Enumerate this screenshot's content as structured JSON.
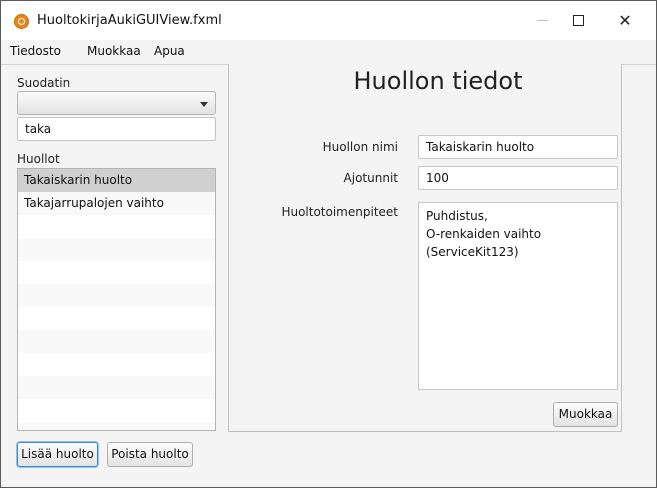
{
  "window": {
    "title": "HuoltokirjaAukiGUIView.fxml",
    "app_icon": "app-icon",
    "minimize_icon": "minimize-icon",
    "maximize_icon": "maximize-icon",
    "close_icon": "close-icon",
    "close_glyph": "✕"
  },
  "menubar": {
    "items": [
      {
        "label": "Tiedosto"
      },
      {
        "label": "Muokkaa"
      },
      {
        "label": "Apua"
      }
    ]
  },
  "filter": {
    "label": "Suodatin",
    "combo_value": "",
    "text_value": "taka"
  },
  "list": {
    "label": "Huollot",
    "items": [
      {
        "label": "Takaiskarin huolto",
        "selected": true
      },
      {
        "label": "Takajarrupalojen vaihto",
        "selected": false
      }
    ]
  },
  "details": {
    "heading": "Huollon tiedot",
    "name_label": "Huollon nimi",
    "name_value": "Takaiskarin huolto",
    "hours_label": "Ajotunnit",
    "hours_value": "100",
    "ops_label": "Huoltotoimenpiteet",
    "ops_lines": [
      "Puhdistus,",
      "O-renkaiden vaihto (ServiceKit123)"
    ],
    "edit_button": "Muokkaa"
  },
  "buttons": {
    "add": "Lisää huolto",
    "remove": "Poista huolto"
  },
  "colors": {
    "selection": "#d0d0d0",
    "focus_border": "#3c89d3",
    "app_icon": "#e8861a"
  }
}
